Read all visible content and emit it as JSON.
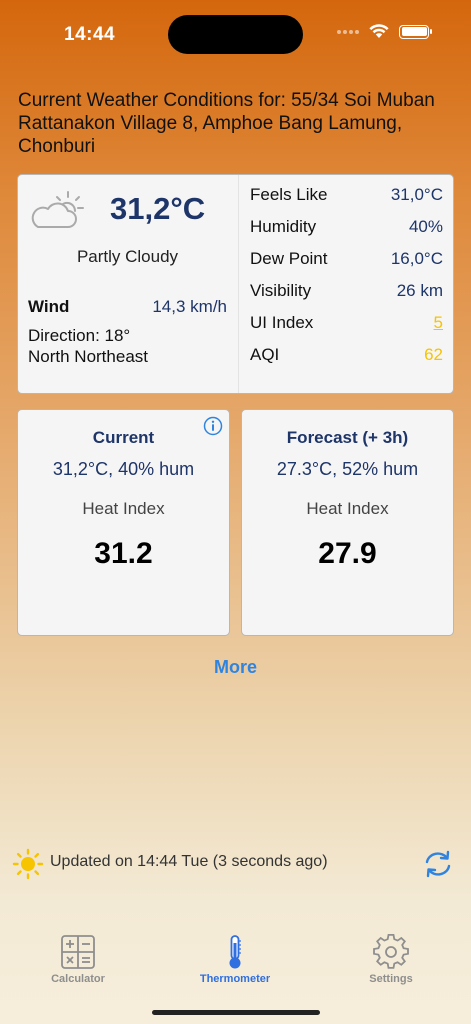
{
  "status": {
    "time": "14:44"
  },
  "location": {
    "title": "Current Weather Conditions for: 55/34 Soi Muban Rattanakon Village 8, Amphoe Bang Lamung, Chonburi"
  },
  "current": {
    "icon": "partly-cloudy-icon",
    "temperature": "31,2°C",
    "condition": "Partly Cloudy",
    "wind_label": "Wind",
    "wind_value": "14,3 km/h",
    "direction_line1": "Direction: 18°",
    "direction_line2": "North Northeast"
  },
  "details": [
    {
      "label": "Feels Like",
      "value": "31,0°C"
    },
    {
      "label": "Humidity",
      "value": "40%"
    },
    {
      "label": "Dew Point",
      "value": "16,0°C"
    },
    {
      "label": "Visibility",
      "value": "26 km"
    },
    {
      "label": "UI Index",
      "value": "5"
    },
    {
      "label": "AQI",
      "value": "62"
    }
  ],
  "heat_current": {
    "title": "Current",
    "summary": "31,2°C, 40% hum",
    "label": "Heat Index",
    "value": "31.2"
  },
  "heat_forecast": {
    "title": "Forecast (+ 3h)",
    "summary": "27.3°C, 52% hum",
    "label": "Heat Index",
    "value": "27.9"
  },
  "more_label": "More",
  "update": {
    "text": "Updated on 14:44 Tue (3 seconds ago)"
  },
  "tabs": [
    {
      "label": "Calculator",
      "icon": "calculator-icon"
    },
    {
      "label": "Thermometer",
      "icon": "thermometer-icon"
    },
    {
      "label": "Settings",
      "icon": "gear-icon"
    }
  ],
  "colors": {
    "accent": "#2f84e0",
    "value_navy": "#1e3569",
    "warning_yellow": "#f6c400",
    "tab_active": "#2f6fe0",
    "tab_inactive": "#8e8e8e"
  }
}
